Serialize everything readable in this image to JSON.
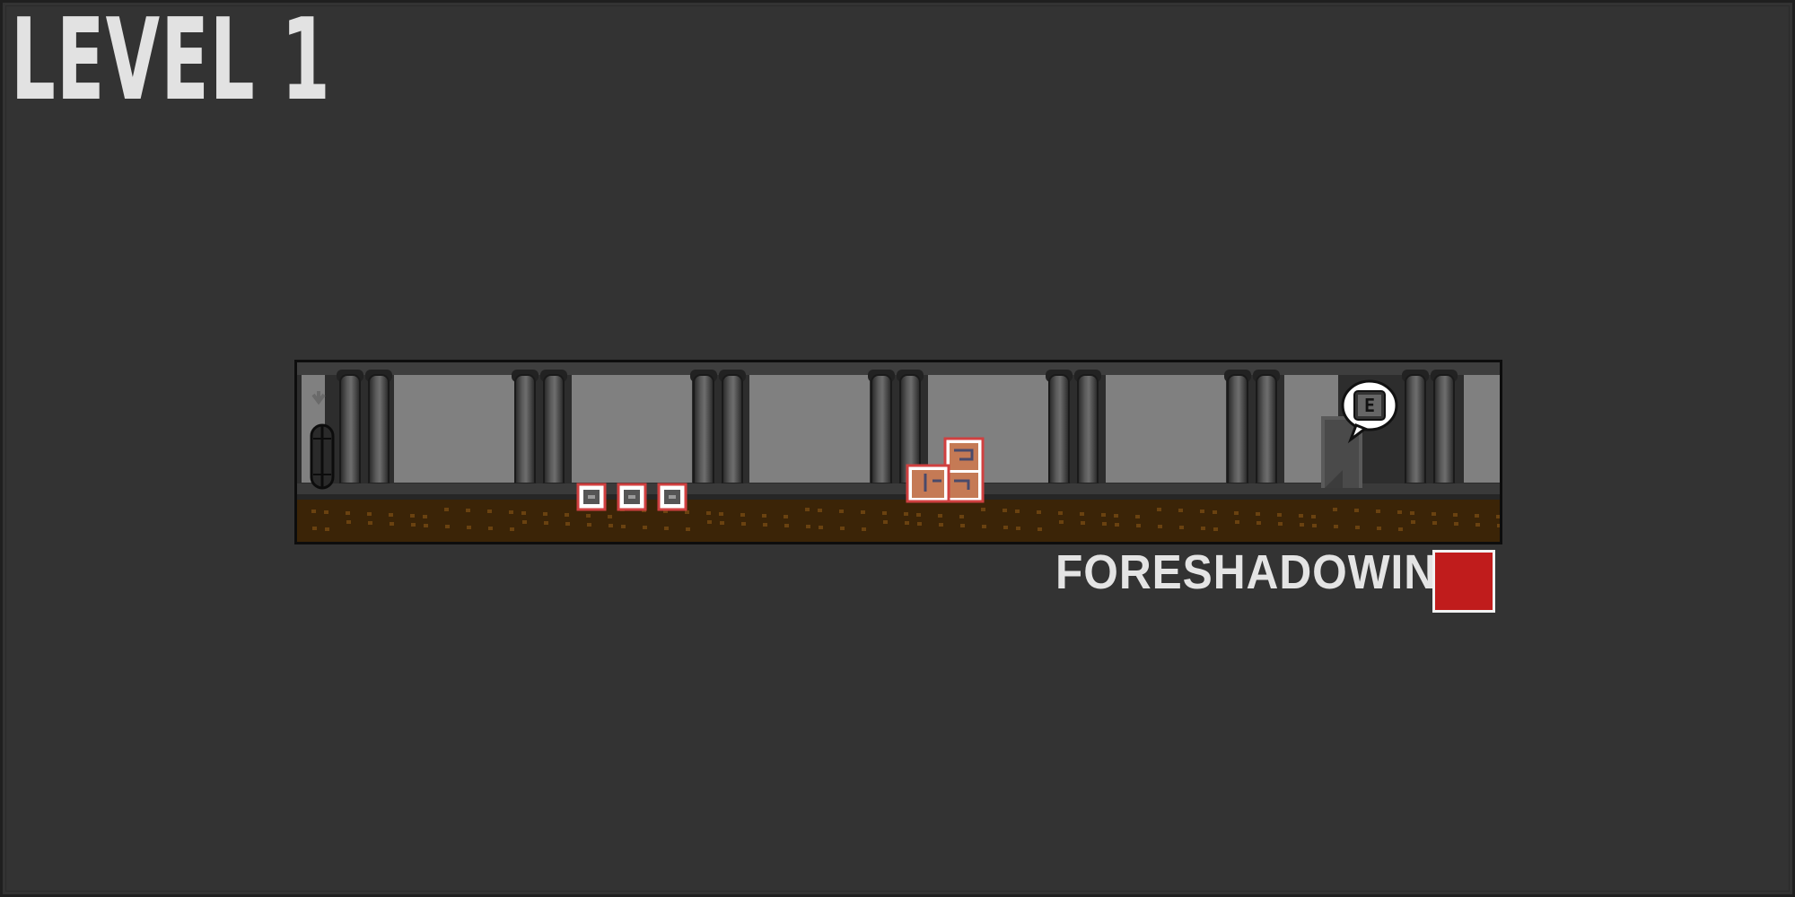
{
  "level": {
    "title": "LEVEL 1",
    "name": "FORESHADOWING"
  },
  "hud": {
    "status_color": "#c01c1c"
  },
  "scene": {
    "background": "#2d2d2d",
    "wall_panel_color": "#808080",
    "pillar_color": "#3a3a3a",
    "floor_color": "#3b2407",
    "dirt_speck_color": "#6a4210",
    "crate_color": "#c57a55",
    "highlight_color": "#d04040",
    "spawn_arrow_icon": "down-arrow-icon",
    "exit_prompt_key": "E"
  }
}
